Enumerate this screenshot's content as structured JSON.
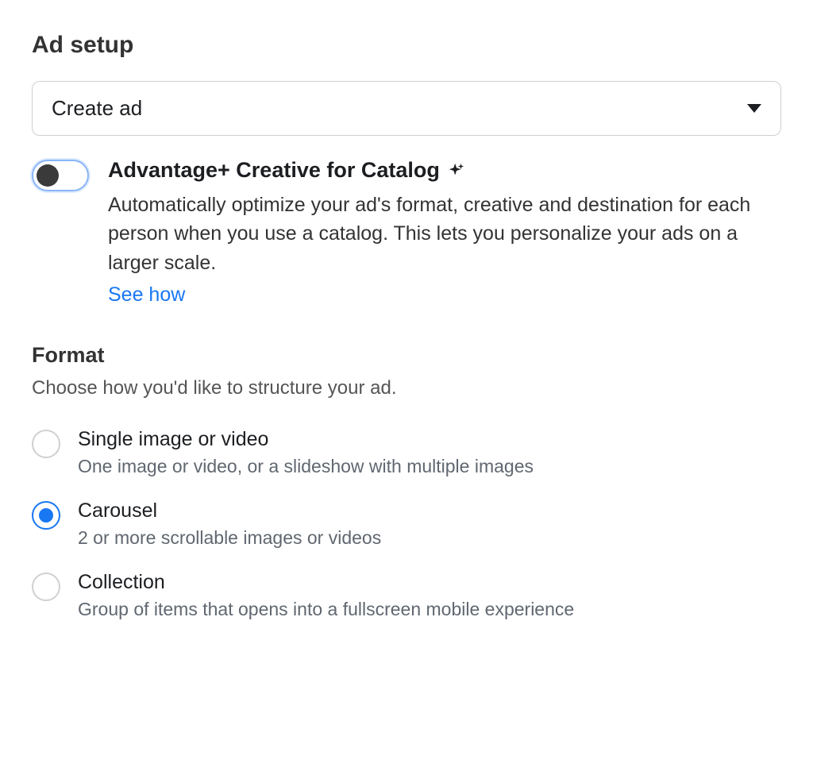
{
  "header": {
    "title": "Ad setup"
  },
  "dropdown": {
    "selected": "Create ad"
  },
  "advantage": {
    "title": "Advantage+ Creative for Catalog",
    "description": "Automatically optimize your ad's format, creative and destination for each person when you use a catalog. This lets you personalize your ads on a larger scale.",
    "link": "See how",
    "enabled": false
  },
  "format": {
    "heading": "Format",
    "sub": "Choose how you'd like to structure your ad.",
    "selectedIndex": 1,
    "options": [
      {
        "label": "Single image or video",
        "desc": "One image or video, or a slideshow with multiple images"
      },
      {
        "label": "Carousel",
        "desc": "2 or more scrollable images or videos"
      },
      {
        "label": "Collection",
        "desc": "Group of items that opens into a fullscreen mobile experience"
      }
    ]
  }
}
